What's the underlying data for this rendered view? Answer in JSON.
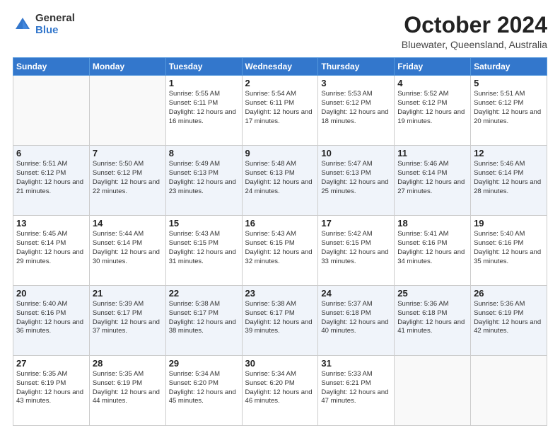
{
  "header": {
    "logo_general": "General",
    "logo_blue": "Blue",
    "month_title": "October 2024",
    "subtitle": "Bluewater, Queensland, Australia"
  },
  "days_of_week": [
    "Sunday",
    "Monday",
    "Tuesday",
    "Wednesday",
    "Thursday",
    "Friday",
    "Saturday"
  ],
  "weeks": [
    [
      {
        "day": "",
        "info": ""
      },
      {
        "day": "",
        "info": ""
      },
      {
        "day": "1",
        "info": "Sunrise: 5:55 AM\nSunset: 6:11 PM\nDaylight: 12 hours and 16 minutes."
      },
      {
        "day": "2",
        "info": "Sunrise: 5:54 AM\nSunset: 6:11 PM\nDaylight: 12 hours and 17 minutes."
      },
      {
        "day": "3",
        "info": "Sunrise: 5:53 AM\nSunset: 6:12 PM\nDaylight: 12 hours and 18 minutes."
      },
      {
        "day": "4",
        "info": "Sunrise: 5:52 AM\nSunset: 6:12 PM\nDaylight: 12 hours and 19 minutes."
      },
      {
        "day": "5",
        "info": "Sunrise: 5:51 AM\nSunset: 6:12 PM\nDaylight: 12 hours and 20 minutes."
      }
    ],
    [
      {
        "day": "6",
        "info": "Sunrise: 5:51 AM\nSunset: 6:12 PM\nDaylight: 12 hours and 21 minutes."
      },
      {
        "day": "7",
        "info": "Sunrise: 5:50 AM\nSunset: 6:12 PM\nDaylight: 12 hours and 22 minutes."
      },
      {
        "day": "8",
        "info": "Sunrise: 5:49 AM\nSunset: 6:13 PM\nDaylight: 12 hours and 23 minutes."
      },
      {
        "day": "9",
        "info": "Sunrise: 5:48 AM\nSunset: 6:13 PM\nDaylight: 12 hours and 24 minutes."
      },
      {
        "day": "10",
        "info": "Sunrise: 5:47 AM\nSunset: 6:13 PM\nDaylight: 12 hours and 25 minutes."
      },
      {
        "day": "11",
        "info": "Sunrise: 5:46 AM\nSunset: 6:14 PM\nDaylight: 12 hours and 27 minutes."
      },
      {
        "day": "12",
        "info": "Sunrise: 5:46 AM\nSunset: 6:14 PM\nDaylight: 12 hours and 28 minutes."
      }
    ],
    [
      {
        "day": "13",
        "info": "Sunrise: 5:45 AM\nSunset: 6:14 PM\nDaylight: 12 hours and 29 minutes."
      },
      {
        "day": "14",
        "info": "Sunrise: 5:44 AM\nSunset: 6:14 PM\nDaylight: 12 hours and 30 minutes."
      },
      {
        "day": "15",
        "info": "Sunrise: 5:43 AM\nSunset: 6:15 PM\nDaylight: 12 hours and 31 minutes."
      },
      {
        "day": "16",
        "info": "Sunrise: 5:43 AM\nSunset: 6:15 PM\nDaylight: 12 hours and 32 minutes."
      },
      {
        "day": "17",
        "info": "Sunrise: 5:42 AM\nSunset: 6:15 PM\nDaylight: 12 hours and 33 minutes."
      },
      {
        "day": "18",
        "info": "Sunrise: 5:41 AM\nSunset: 6:16 PM\nDaylight: 12 hours and 34 minutes."
      },
      {
        "day": "19",
        "info": "Sunrise: 5:40 AM\nSunset: 6:16 PM\nDaylight: 12 hours and 35 minutes."
      }
    ],
    [
      {
        "day": "20",
        "info": "Sunrise: 5:40 AM\nSunset: 6:16 PM\nDaylight: 12 hours and 36 minutes."
      },
      {
        "day": "21",
        "info": "Sunrise: 5:39 AM\nSunset: 6:17 PM\nDaylight: 12 hours and 37 minutes."
      },
      {
        "day": "22",
        "info": "Sunrise: 5:38 AM\nSunset: 6:17 PM\nDaylight: 12 hours and 38 minutes."
      },
      {
        "day": "23",
        "info": "Sunrise: 5:38 AM\nSunset: 6:17 PM\nDaylight: 12 hours and 39 minutes."
      },
      {
        "day": "24",
        "info": "Sunrise: 5:37 AM\nSunset: 6:18 PM\nDaylight: 12 hours and 40 minutes."
      },
      {
        "day": "25",
        "info": "Sunrise: 5:36 AM\nSunset: 6:18 PM\nDaylight: 12 hours and 41 minutes."
      },
      {
        "day": "26",
        "info": "Sunrise: 5:36 AM\nSunset: 6:19 PM\nDaylight: 12 hours and 42 minutes."
      }
    ],
    [
      {
        "day": "27",
        "info": "Sunrise: 5:35 AM\nSunset: 6:19 PM\nDaylight: 12 hours and 43 minutes."
      },
      {
        "day": "28",
        "info": "Sunrise: 5:35 AM\nSunset: 6:19 PM\nDaylight: 12 hours and 44 minutes."
      },
      {
        "day": "29",
        "info": "Sunrise: 5:34 AM\nSunset: 6:20 PM\nDaylight: 12 hours and 45 minutes."
      },
      {
        "day": "30",
        "info": "Sunrise: 5:34 AM\nSunset: 6:20 PM\nDaylight: 12 hours and 46 minutes."
      },
      {
        "day": "31",
        "info": "Sunrise: 5:33 AM\nSunset: 6:21 PM\nDaylight: 12 hours and 47 minutes."
      },
      {
        "day": "",
        "info": ""
      },
      {
        "day": "",
        "info": ""
      }
    ]
  ]
}
